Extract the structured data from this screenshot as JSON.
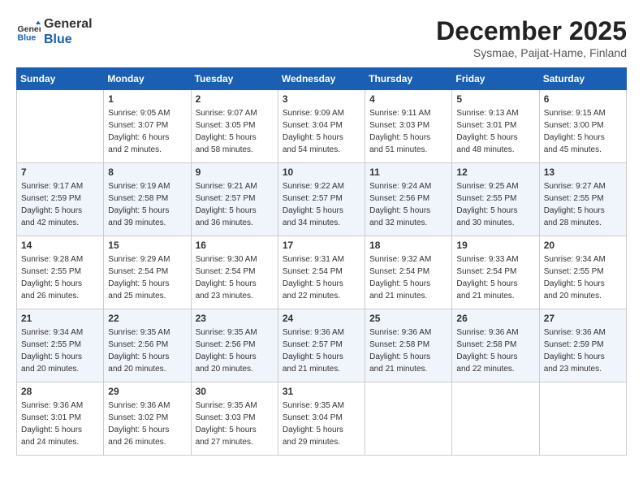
{
  "header": {
    "logo_line1": "General",
    "logo_line2": "Blue",
    "title": "December 2025",
    "subtitle": "Sysmae, Paijat-Hame, Finland"
  },
  "days_of_week": [
    "Sunday",
    "Monday",
    "Tuesday",
    "Wednesday",
    "Thursday",
    "Friday",
    "Saturday"
  ],
  "weeks": [
    [
      {
        "day": "",
        "info": ""
      },
      {
        "day": "1",
        "info": "Sunrise: 9:05 AM\nSunset: 3:07 PM\nDaylight: 6 hours\nand 2 minutes."
      },
      {
        "day": "2",
        "info": "Sunrise: 9:07 AM\nSunset: 3:05 PM\nDaylight: 5 hours\nand 58 minutes."
      },
      {
        "day": "3",
        "info": "Sunrise: 9:09 AM\nSunset: 3:04 PM\nDaylight: 5 hours\nand 54 minutes."
      },
      {
        "day": "4",
        "info": "Sunrise: 9:11 AM\nSunset: 3:03 PM\nDaylight: 5 hours\nand 51 minutes."
      },
      {
        "day": "5",
        "info": "Sunrise: 9:13 AM\nSunset: 3:01 PM\nDaylight: 5 hours\nand 48 minutes."
      },
      {
        "day": "6",
        "info": "Sunrise: 9:15 AM\nSunset: 3:00 PM\nDaylight: 5 hours\nand 45 minutes."
      }
    ],
    [
      {
        "day": "7",
        "info": "Sunrise: 9:17 AM\nSunset: 2:59 PM\nDaylight: 5 hours\nand 42 minutes."
      },
      {
        "day": "8",
        "info": "Sunrise: 9:19 AM\nSunset: 2:58 PM\nDaylight: 5 hours\nand 39 minutes."
      },
      {
        "day": "9",
        "info": "Sunrise: 9:21 AM\nSunset: 2:57 PM\nDaylight: 5 hours\nand 36 minutes."
      },
      {
        "day": "10",
        "info": "Sunrise: 9:22 AM\nSunset: 2:57 PM\nDaylight: 5 hours\nand 34 minutes."
      },
      {
        "day": "11",
        "info": "Sunrise: 9:24 AM\nSunset: 2:56 PM\nDaylight: 5 hours\nand 32 minutes."
      },
      {
        "day": "12",
        "info": "Sunrise: 9:25 AM\nSunset: 2:55 PM\nDaylight: 5 hours\nand 30 minutes."
      },
      {
        "day": "13",
        "info": "Sunrise: 9:27 AM\nSunset: 2:55 PM\nDaylight: 5 hours\nand 28 minutes."
      }
    ],
    [
      {
        "day": "14",
        "info": "Sunrise: 9:28 AM\nSunset: 2:55 PM\nDaylight: 5 hours\nand 26 minutes."
      },
      {
        "day": "15",
        "info": "Sunrise: 9:29 AM\nSunset: 2:54 PM\nDaylight: 5 hours\nand 25 minutes."
      },
      {
        "day": "16",
        "info": "Sunrise: 9:30 AM\nSunset: 2:54 PM\nDaylight: 5 hours\nand 23 minutes."
      },
      {
        "day": "17",
        "info": "Sunrise: 9:31 AM\nSunset: 2:54 PM\nDaylight: 5 hours\nand 22 minutes."
      },
      {
        "day": "18",
        "info": "Sunrise: 9:32 AM\nSunset: 2:54 PM\nDaylight: 5 hours\nand 21 minutes."
      },
      {
        "day": "19",
        "info": "Sunrise: 9:33 AM\nSunset: 2:54 PM\nDaylight: 5 hours\nand 21 minutes."
      },
      {
        "day": "20",
        "info": "Sunrise: 9:34 AM\nSunset: 2:55 PM\nDaylight: 5 hours\nand 20 minutes."
      }
    ],
    [
      {
        "day": "21",
        "info": "Sunrise: 9:34 AM\nSunset: 2:55 PM\nDaylight: 5 hours\nand 20 minutes."
      },
      {
        "day": "22",
        "info": "Sunrise: 9:35 AM\nSunset: 2:56 PM\nDaylight: 5 hours\nand 20 minutes."
      },
      {
        "day": "23",
        "info": "Sunrise: 9:35 AM\nSunset: 2:56 PM\nDaylight: 5 hours\nand 20 minutes."
      },
      {
        "day": "24",
        "info": "Sunrise: 9:36 AM\nSunset: 2:57 PM\nDaylight: 5 hours\nand 21 minutes."
      },
      {
        "day": "25",
        "info": "Sunrise: 9:36 AM\nSunset: 2:58 PM\nDaylight: 5 hours\nand 21 minutes."
      },
      {
        "day": "26",
        "info": "Sunrise: 9:36 AM\nSunset: 2:58 PM\nDaylight: 5 hours\nand 22 minutes."
      },
      {
        "day": "27",
        "info": "Sunrise: 9:36 AM\nSunset: 2:59 PM\nDaylight: 5 hours\nand 23 minutes."
      }
    ],
    [
      {
        "day": "28",
        "info": "Sunrise: 9:36 AM\nSunset: 3:01 PM\nDaylight: 5 hours\nand 24 minutes."
      },
      {
        "day": "29",
        "info": "Sunrise: 9:36 AM\nSunset: 3:02 PM\nDaylight: 5 hours\nand 26 minutes."
      },
      {
        "day": "30",
        "info": "Sunrise: 9:35 AM\nSunset: 3:03 PM\nDaylight: 5 hours\nand 27 minutes."
      },
      {
        "day": "31",
        "info": "Sunrise: 9:35 AM\nSunset: 3:04 PM\nDaylight: 5 hours\nand 29 minutes."
      },
      {
        "day": "",
        "info": ""
      },
      {
        "day": "",
        "info": ""
      },
      {
        "day": "",
        "info": ""
      }
    ]
  ]
}
